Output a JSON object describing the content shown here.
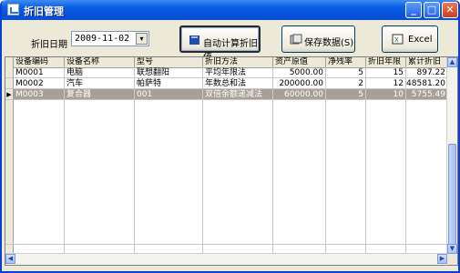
{
  "window": {
    "title": "折旧管理"
  },
  "titlebar_buttons": {
    "minimize": "_",
    "maximize": "□",
    "close": "✕"
  },
  "form": {
    "date_label": "折旧日期",
    "date_value": "2009-11-02"
  },
  "buttons": {
    "calc": "自动计算折旧值",
    "save": "保存数据(S)",
    "excel": "Excel"
  },
  "table": {
    "headers": [
      "设备编码",
      "设备名称",
      "型号",
      "折旧方法",
      "资产原值",
      "净残率",
      "折旧年限",
      "累计折旧"
    ],
    "rows": [
      [
        "M0001",
        "电脑",
        "联想翻阳",
        "平均年限法",
        "5000.00",
        "5",
        "15",
        "897.22"
      ],
      [
        "M0002",
        "汽车",
        "帕萨特",
        "年数总和法",
        "200000.00",
        "2",
        "12",
        "48581.20"
      ],
      [
        "M0003",
        "复合器",
        "001",
        "双倍余额递减法",
        "60000.00",
        "5",
        "10",
        "5755.49"
      ]
    ],
    "selected_row": 2
  },
  "colors": {
    "titlebar": "#0a5fe6",
    "selected_row": "#a8a098",
    "window_bg": "#ece9d8"
  }
}
